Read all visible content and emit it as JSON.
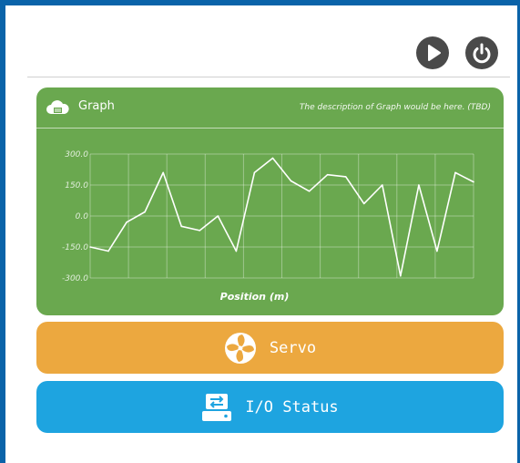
{
  "toolbar": {
    "play_icon": "play-icon",
    "power_icon": "power-icon"
  },
  "graph_panel": {
    "title": "Graph",
    "description": "The description of Graph would be here. (TBD)",
    "icon": "cloud-icon"
  },
  "servo_panel": {
    "label": "Servo",
    "icon": "fan-icon"
  },
  "io_panel": {
    "label": "I/O Status",
    "icon": "drive-transfer-icon"
  },
  "colors": {
    "frame": "#0a63a9",
    "graph_bg": "#6aa84f",
    "servo_bg": "#eca83f",
    "io_bg": "#1ea4e0",
    "button_bg": "#4a4a4a"
  },
  "chart_data": {
    "type": "line",
    "xlabel": "Position (m)",
    "ylabel": "",
    "ylim": [
      -300,
      300
    ],
    "yticks": [
      "300.0",
      "150.0",
      "0.0",
      "-150.0",
      "-300.0"
    ],
    "grid": true,
    "series": [
      {
        "values": [
          -150,
          -170,
          -30,
          20,
          210,
          -50,
          -70,
          0,
          -170,
          210,
          280,
          170,
          120,
          200,
          190,
          60,
          150,
          -290,
          150,
          -170,
          210,
          165
        ]
      }
    ]
  }
}
